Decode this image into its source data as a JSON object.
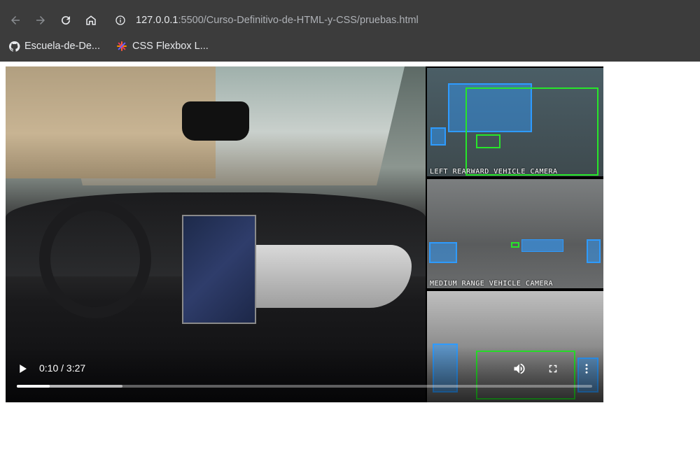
{
  "browser": {
    "url_host": "127.0.0.1",
    "url_rest": ":5500/Curso-Definitivo-de-HTML-y-CSS/pruebas.html",
    "nav": {
      "back_icon": "arrow-left-icon",
      "forward_icon": "arrow-right-icon",
      "reload_icon": "reload-icon",
      "home_icon": "home-icon",
      "info_icon": "info-icon"
    },
    "bookmarks": [
      {
        "label": "Escuela-de-De...",
        "icon": "github-icon"
      },
      {
        "label": "CSS Flexbox L...",
        "icon": "asterisk-logo-icon"
      }
    ]
  },
  "video": {
    "current_time": "0:10",
    "duration": "3:27",
    "time_display": "0:10 / 3:27",
    "progress_fraction": 0.057,
    "buffered_fraction": 0.184,
    "camera_labels": [
      "LEFT REARWARD VEHICLE CAMERA",
      "MEDIUM RANGE VEHICLE CAMERA"
    ],
    "icons": {
      "play": "play-icon",
      "volume": "volume-icon",
      "fullscreen": "fullscreen-icon",
      "more": "more-vertical-icon"
    }
  },
  "colors": {
    "chrome_bg": "#3c3c3c",
    "detection_blue": "#2e9bff",
    "detection_green": "#27e62a"
  }
}
